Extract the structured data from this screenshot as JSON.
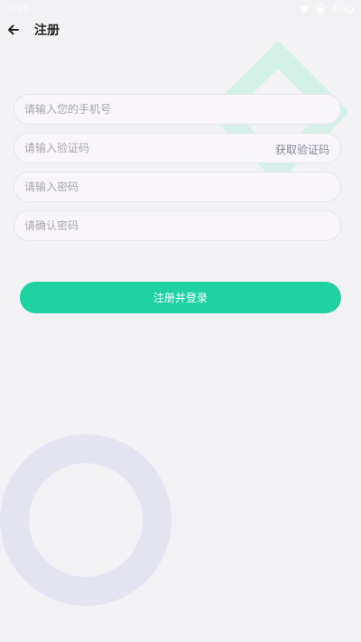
{
  "status_bar": {
    "time_left": "4:30",
    "time_right": "4:30"
  },
  "header": {
    "back_icon": "arrow-left-icon",
    "title": "注册"
  },
  "form": {
    "phone_placeholder": "请输入您的手机号",
    "code_placeholder": "请输入验证码",
    "get_code_label": "获取验证码",
    "password_placeholder": "请输入密码",
    "confirm_password_placeholder": "请确认密码",
    "submit_label": "注册并登录"
  },
  "colors": {
    "accent": "#1fd2a1",
    "background": "#f2f2f4",
    "ring": "#e3e3f1",
    "diamond": "#c8f0e1"
  }
}
